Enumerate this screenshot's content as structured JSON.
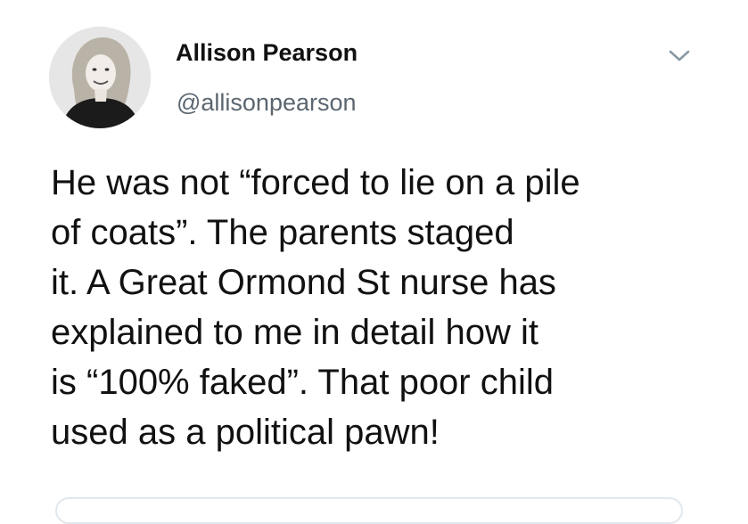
{
  "author": {
    "display_name": "Allison Pearson",
    "handle": "@allisonpearson",
    "avatar_icon": "profile-photo"
  },
  "menu": {
    "icon": "chevron-down-icon"
  },
  "tweet": {
    "lines": [
      "He was not “forced to lie on a pile",
      "of coats”. The parents staged",
      "it. A Great Ormond St nurse has",
      "explained to me in detail how it",
      "is “100% faked”. That poor child",
      "used as a political pawn!"
    ]
  },
  "colors": {
    "text": "#111111",
    "secondary_text": "#5b6670",
    "caret": "#8899a6",
    "border": "#e1e8ed"
  }
}
